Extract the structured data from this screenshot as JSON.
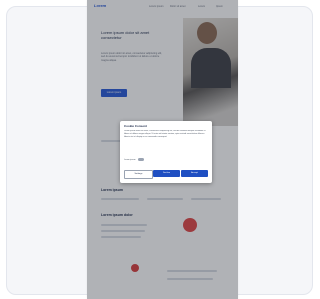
{
  "site": {
    "logo": "Lorem",
    "nav": [
      "Lorem ipsum",
      "Dolor sit amet",
      "Lorem",
      "Ipsum"
    ],
    "hero": {
      "title": "Lorem ipsum dolor sit amet consectetur",
      "text": "Lorem ipsum dolor sit amet, consectetur adipiscing elit, sed do eiusmod tempor incididunt ut labore et dolore magna aliqua.",
      "cta": "Lorem ipsum"
    },
    "sections": [
      "Lorem ipsum",
      "Lorem ipsum dolor"
    ]
  },
  "consent": {
    "title": "Cookie Consent",
    "body": "Lorem ipsum dolor sit amet, consectetur adipiscing elit, sed do eiusmod tempor incididunt ut labore et dolore magna aliqua. Ut enim ad minim veniam, quis nostrud exercitation ullamco laboris nisi ut aliquip ex ea commodo consequat.",
    "toggle_label": "Lorem ipsum",
    "buttons": {
      "settings": "Settings",
      "decline": "Decline",
      "accept": "Accept"
    }
  },
  "colors": {
    "accent": "#1f4fc2",
    "overlay": "rgba(30,35,45,0.35)"
  }
}
